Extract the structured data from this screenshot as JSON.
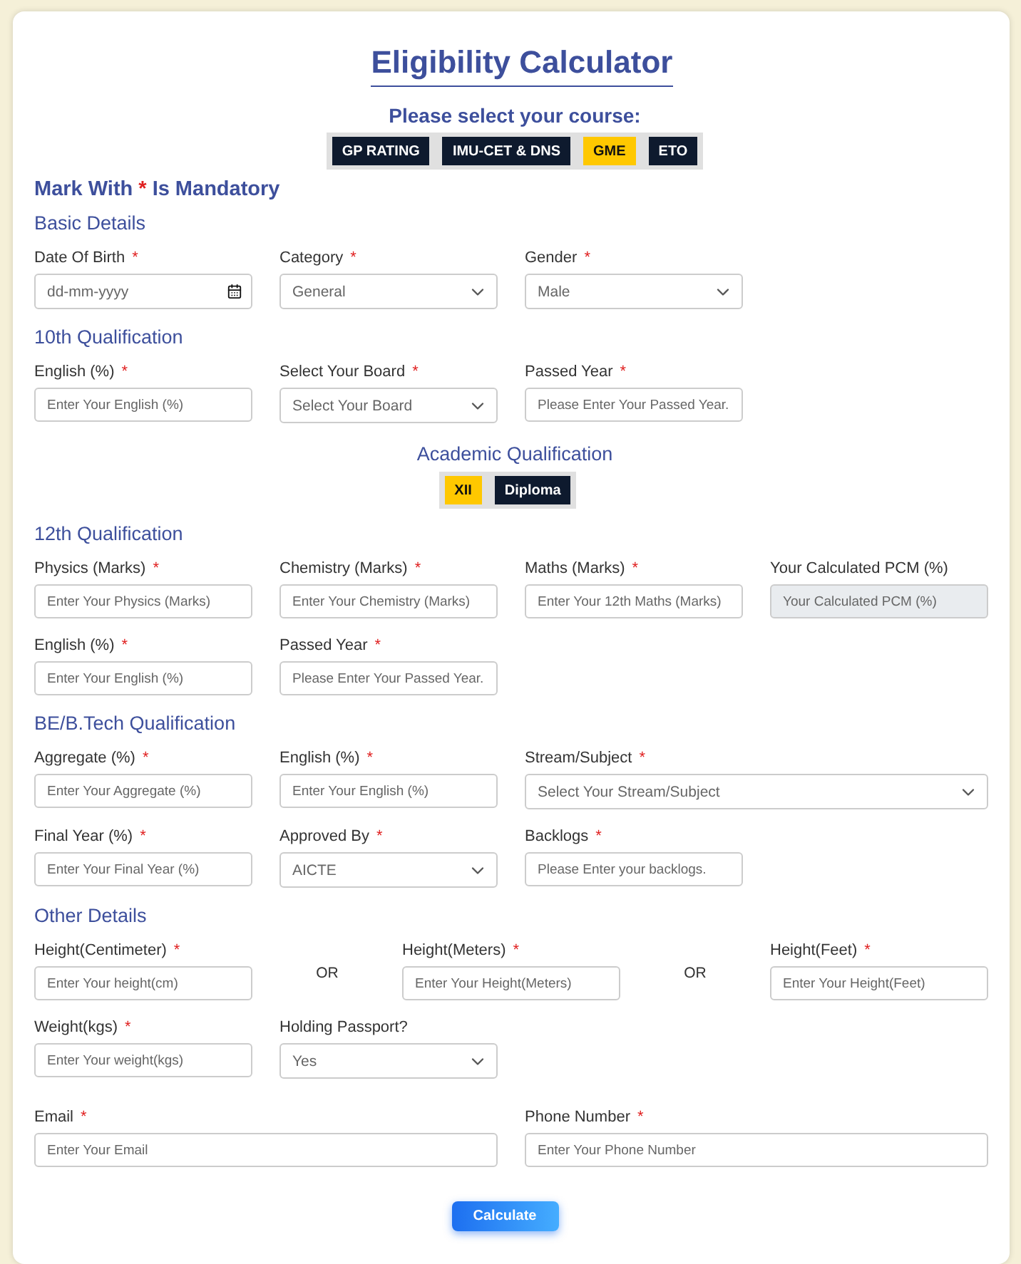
{
  "title": "Eligibility Calculator",
  "course_prompt": "Please select your course:",
  "courses": [
    {
      "label": "GP RATING",
      "selected": false
    },
    {
      "label": "IMU-CET & DNS",
      "selected": false
    },
    {
      "label": "GME",
      "selected": true
    },
    {
      "label": "ETO",
      "selected": false
    }
  ],
  "mandatory_note": {
    "before": "Mark With",
    "mark": "*",
    "after": "Is Mandatory"
  },
  "sections": [
    {
      "kind": "fields",
      "heading": "Basic Details",
      "rows": [
        [
          {
            "kind": "date",
            "label": "Date Of Birth",
            "mark": "*",
            "placeholder": "dd-mm-yyyy"
          },
          {
            "kind": "select",
            "label": "Category",
            "mark": "*",
            "value": "General"
          },
          {
            "kind": "select",
            "label": "Gender",
            "mark": "*",
            "value": "Male"
          }
        ]
      ]
    },
    {
      "kind": "fields",
      "heading": "10th Qualification",
      "rows": [
        [
          {
            "kind": "text",
            "label": "English (%)",
            "mark": "*",
            "placeholder": "Enter Your English (%)"
          },
          {
            "kind": "select",
            "label": "Select Your Board",
            "mark": "*",
            "value": "Select Your Board"
          },
          {
            "kind": "text",
            "label": "Passed Year",
            "mark": "*",
            "placeholder": "Please Enter Your Passed Year."
          }
        ]
      ]
    },
    {
      "kind": "choice",
      "heading": "Academic Qualification",
      "options": [
        {
          "label": "XII",
          "selected": true
        },
        {
          "label": "Diploma",
          "selected": false
        }
      ]
    },
    {
      "kind": "fields",
      "heading": "12th Qualification",
      "rows": [
        [
          {
            "kind": "text",
            "label": "Physics (Marks)",
            "mark": "*",
            "placeholder": "Enter Your Physics (Marks)"
          },
          {
            "kind": "text",
            "label": "Chemistry (Marks)",
            "mark": "*",
            "placeholder": "Enter Your Chemistry (Marks)"
          },
          {
            "kind": "text",
            "label": "Maths (Marks)",
            "mark": "*",
            "placeholder": "Enter Your 12th Maths (Marks)"
          },
          {
            "kind": "readonly",
            "label": "Your Calculated PCM (%)",
            "placeholder": "Your Calculated PCM (%)"
          }
        ],
        [
          {
            "kind": "text",
            "label": "English (%)",
            "mark": "*",
            "placeholder": "Enter Your English (%)"
          },
          {
            "kind": "text",
            "label": "Passed Year",
            "mark": "*",
            "placeholder": "Please Enter Your Passed Year."
          }
        ]
      ]
    },
    {
      "kind": "fields",
      "heading": "BE/B.Tech Qualification",
      "rows": [
        [
          {
            "kind": "text",
            "label": "Aggregate (%)",
            "mark": "*",
            "placeholder": "Enter Your Aggregate (%)"
          },
          {
            "kind": "text",
            "label": "English (%)",
            "mark": "*",
            "placeholder": "Enter Your English (%)"
          },
          {
            "kind": "select",
            "label": "Stream/Subject",
            "mark": "*",
            "value": "Select Your Stream/Subject",
            "wide": true
          }
        ],
        [
          {
            "kind": "text",
            "label": "Final Year (%)",
            "mark": "*",
            "placeholder": "Enter Your Final Year (%)"
          },
          {
            "kind": "select",
            "label": "Approved By",
            "mark": "*",
            "value": "AICTE"
          },
          {
            "kind": "text",
            "label": "Backlogs",
            "mark": "*",
            "placeholder": "Please Enter your backlogs."
          }
        ]
      ]
    },
    {
      "kind": "fields",
      "heading": "Other Details",
      "rows": [
        [
          {
            "kind": "text",
            "label": "Height(Centimeter)",
            "mark": "*",
            "placeholder": "Enter Your height(cm)"
          },
          {
            "kind": "or",
            "text": "OR"
          },
          {
            "kind": "text",
            "label": "Height(Meters)",
            "mark": "*",
            "placeholder": "Enter Your Height(Meters)"
          },
          {
            "kind": "or",
            "text": "OR"
          },
          {
            "kind": "text",
            "label": "Height(Feet)",
            "mark": "*",
            "placeholder": "Enter Your Height(Feet)"
          }
        ],
        [
          {
            "kind": "text",
            "label": "Weight(kgs)",
            "mark": "*",
            "placeholder": "Enter Your weight(kgs)"
          },
          {
            "kind": "select",
            "label": "Holding Passport?",
            "value": "Yes"
          }
        ]
      ]
    },
    {
      "kind": "fields",
      "rows": [
        [
          {
            "kind": "text",
            "label": "Email",
            "mark": "*",
            "placeholder": "Enter Your Email",
            "wide": true
          },
          {
            "kind": "text",
            "label": "Phone Number",
            "mark": "*",
            "placeholder": "Enter Your Phone Number",
            "wide": true
          }
        ]
      ]
    }
  ],
  "submit": "Calculate"
}
